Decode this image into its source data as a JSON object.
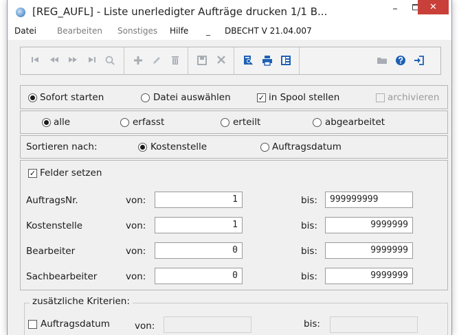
{
  "window": {
    "title": "[REG_AUFL] - Liste unerledigter Aufträge drucken  1/1  B...",
    "controls": {
      "minimize": "–",
      "close": "✕"
    }
  },
  "menubar": {
    "items": [
      "Datei",
      "Bearbeiten",
      "Sonstiges",
      "Hilfe"
    ],
    "separator": "_",
    "version": "DBECHT V 21.04.007"
  },
  "toolbar": {
    "icons": [
      "first-icon",
      "previous-icon",
      "next-icon",
      "last-icon",
      "search-icon",
      "add-icon",
      "edit-icon",
      "delete-icon",
      "save-icon",
      "cancel-icon",
      "print-preview-icon",
      "print-icon",
      "list-icon",
      "folder-icon",
      "help-icon",
      "exit-icon"
    ]
  },
  "start_options": {
    "sofort": "Sofort starten",
    "datei": "Datei auswählen",
    "spool": "in Spool stellen",
    "archiv": "archivieren"
  },
  "status_filter": {
    "alle": "alle",
    "erfasst": "erfasst",
    "erteilt": "erteilt",
    "abgearbeitet": "abgearbeitet"
  },
  "sort": {
    "label": "Sortieren nach:",
    "kostenstelle": "Kostenstelle",
    "datum": "Auftragsdatum"
  },
  "fields": {
    "set_label": "Felder setzen",
    "von_label": "von:",
    "bis_label": "bis:",
    "rows": [
      {
        "label": "AuftragsNr.",
        "from": "1",
        "to": "999999999"
      },
      {
        "label": "Kostenstelle",
        "from": "1",
        "to": "9999999"
      },
      {
        "label": "Bearbeiter",
        "from": "0",
        "to": "9999999"
      },
      {
        "label": "Sachbearbeiter",
        "from": "0",
        "to": "9999999"
      }
    ]
  },
  "extra": {
    "title": "zusätzliche Kriterien:",
    "auftragsdatum": "Auftragsdatum",
    "von_label": "von:",
    "bis_label": "bis:"
  }
}
